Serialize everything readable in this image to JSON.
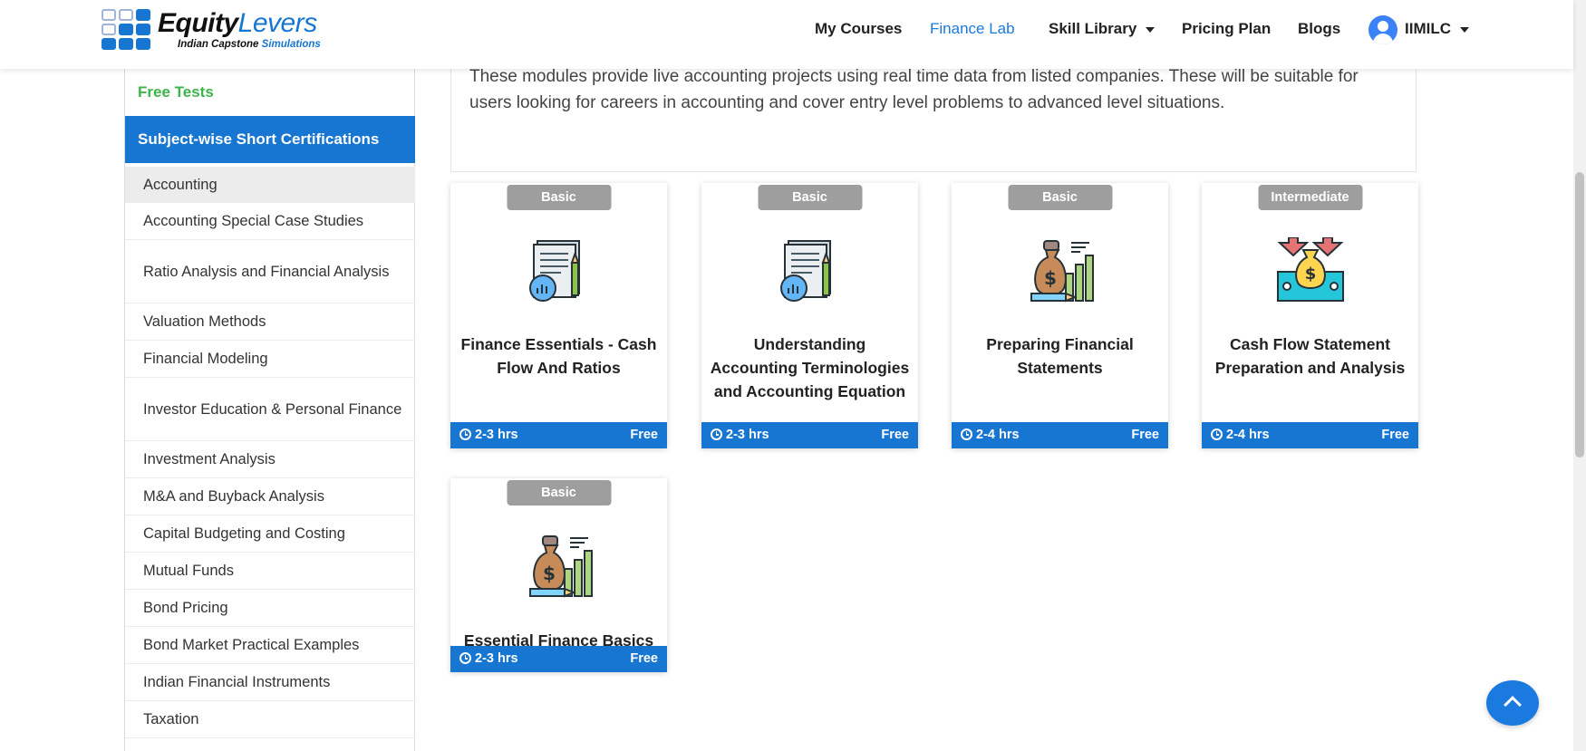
{
  "brand": {
    "name_part1": "Equity",
    "name_part2": "Levers",
    "tagline_part1": "Indian Capstone",
    "tagline_part2": "Simulations"
  },
  "nav": {
    "my_courses": "My Courses",
    "finance_lab": "Finance Lab",
    "skill_library": "Skill Library",
    "pricing_plan": "Pricing Plan",
    "blogs": "Blogs",
    "user": "IIMILC"
  },
  "sidebar": {
    "free_tests": "Free Tests",
    "cert_header": "Subject-wise Short Certifications",
    "items": [
      "Accounting",
      "Accounting Special Case Studies",
      "Ratio Analysis and Financial Analysis",
      "Valuation Methods",
      "Financial Modeling",
      "Investor Education & Personal Finance",
      "Investment Analysis",
      "M&A and Buyback Analysis",
      "Capital Budgeting and Costing",
      "Mutual Funds",
      "Bond Pricing",
      "Bond Market Practical Examples",
      "Indian Financial Instruments",
      "Taxation"
    ],
    "selected": "Accounting"
  },
  "description": "These modules provide live accounting projects using real time data from listed companies. These will be suitable for users looking for careers in accounting and cover entry level problems to advanced level situations.",
  "cards": [
    {
      "level": "Basic",
      "title": "Finance Essentials - Cash Flow And Ratios",
      "duration": "2-3 hrs",
      "price": "Free",
      "icon": "document-chart-icon"
    },
    {
      "level": "Basic",
      "title": "Understanding Accounting Terminologies and Accounting Equation",
      "duration": "2-3 hrs",
      "price": "Free",
      "icon": "document-chart-icon"
    },
    {
      "level": "Basic",
      "title": "Preparing Financial Statements",
      "duration": "2-4 hrs",
      "price": "Free",
      "icon": "money-bag-growth-icon"
    },
    {
      "level": "Intermediate",
      "title": "Cash Flow Statement Preparation and Analysis",
      "duration": "2-4 hrs",
      "price": "Free",
      "icon": "cash-flow-icon"
    },
    {
      "level": "Basic",
      "title": "Essential Finance Basics",
      "duration": "2-3 hrs",
      "price": "Free",
      "icon": "money-bag-growth-icon"
    }
  ],
  "colors": {
    "primary": "#1676d2",
    "free_tests_green": "#3cb54a",
    "badge_gray": "#9e9e9e"
  }
}
